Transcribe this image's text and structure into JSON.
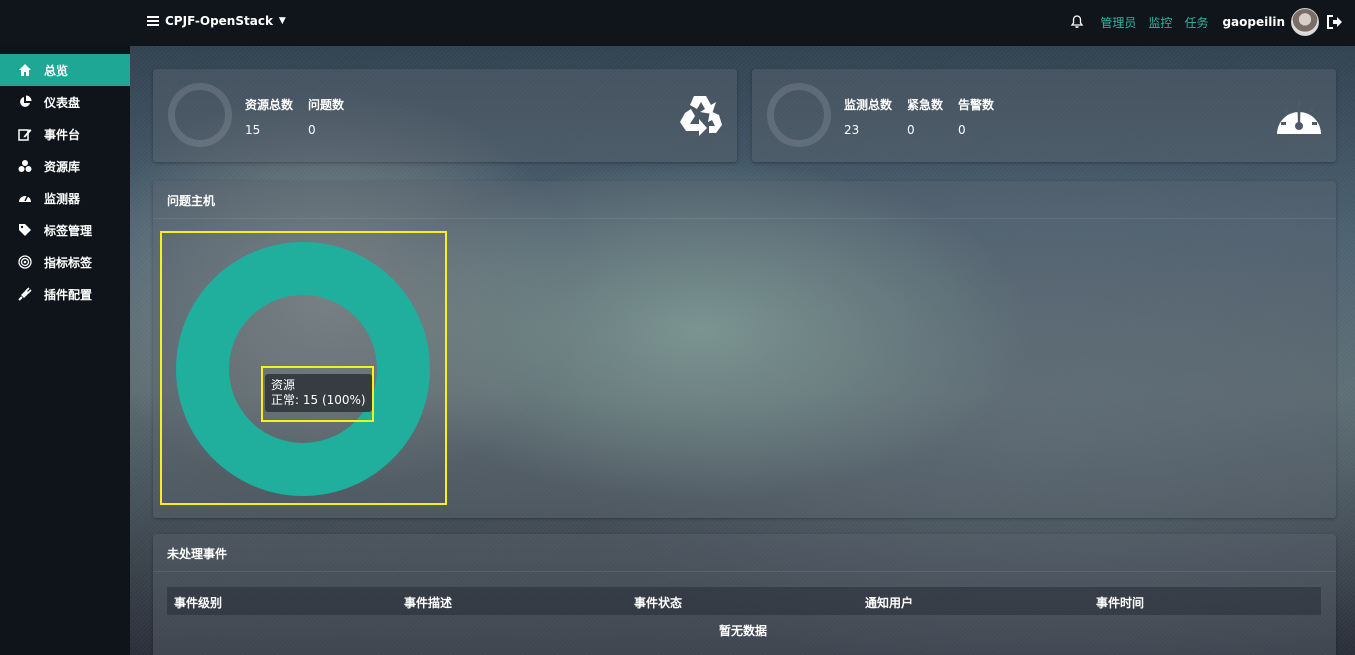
{
  "app": {
    "brand": "CPJF-OpenStack",
    "links": [
      "管理员",
      "监控",
      "任务"
    ],
    "username": "gaopeilin",
    "accent_color": "#1fa795",
    "link_color": "#2fb6a0"
  },
  "sidebar": {
    "items": [
      {
        "label": "总览",
        "icon": "home-icon",
        "active": true
      },
      {
        "label": "仪表盘",
        "icon": "pie-chart-icon"
      },
      {
        "label": "事件台",
        "icon": "edit-icon"
      },
      {
        "label": "资源库",
        "icon": "cubes-icon"
      },
      {
        "label": "监测器",
        "icon": "dashboard-icon"
      },
      {
        "label": "标签管理",
        "icon": "tags-icon"
      },
      {
        "label": "指标标签",
        "icon": "target-icon"
      },
      {
        "label": "插件配置",
        "icon": "plug-icon"
      }
    ]
  },
  "resource_card": {
    "total_label": "资源总数",
    "total_value": "15",
    "issue_label": "问题数",
    "issue_value": "0",
    "icon": "recycle-icon"
  },
  "monitor_card": {
    "total_label": "监测总数",
    "total_value": "23",
    "urgent_label": "紧急数",
    "urgent_value": "0",
    "alarm_label": "告警数",
    "alarm_value": "0",
    "icon": "gauge-icon"
  },
  "problem_hosts": {
    "title": "问题主机",
    "tooltip_title": "资源",
    "tooltip_value": "正常: 15 (100%)"
  },
  "chart_data": {
    "type": "pie",
    "series": [
      {
        "name": "资源",
        "categories": [
          "正常"
        ],
        "values": [
          15
        ]
      }
    ],
    "colors": [
      "#20ae9d"
    ]
  },
  "events": {
    "title": "未处理事件",
    "columns": [
      "事件级别",
      "事件描述",
      "事件状态",
      "通知用户",
      "事件时间"
    ],
    "empty_text": "暂无数据"
  }
}
